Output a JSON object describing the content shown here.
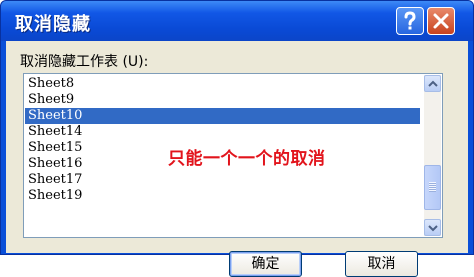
{
  "window": {
    "title": "取消隐藏",
    "help_icon": "question-mark-icon",
    "close_icon": "close-x-icon"
  },
  "list": {
    "label": "取消隐藏工作表 (U):",
    "items": [
      "Sheet8",
      "Sheet9",
      "Sheet10",
      "Sheet14",
      "Sheet15",
      "Sheet16",
      "Sheet17",
      "Sheet19"
    ],
    "selected": "Sheet10"
  },
  "annotation": "只能一个一个的取消",
  "buttons": {
    "ok": "确定",
    "cancel": "取消"
  },
  "colors": {
    "title_bar": "#0a4ad6",
    "selection": "#316ac5",
    "annotation": "#e2141c",
    "dialog_bg": "#ece9d8"
  }
}
